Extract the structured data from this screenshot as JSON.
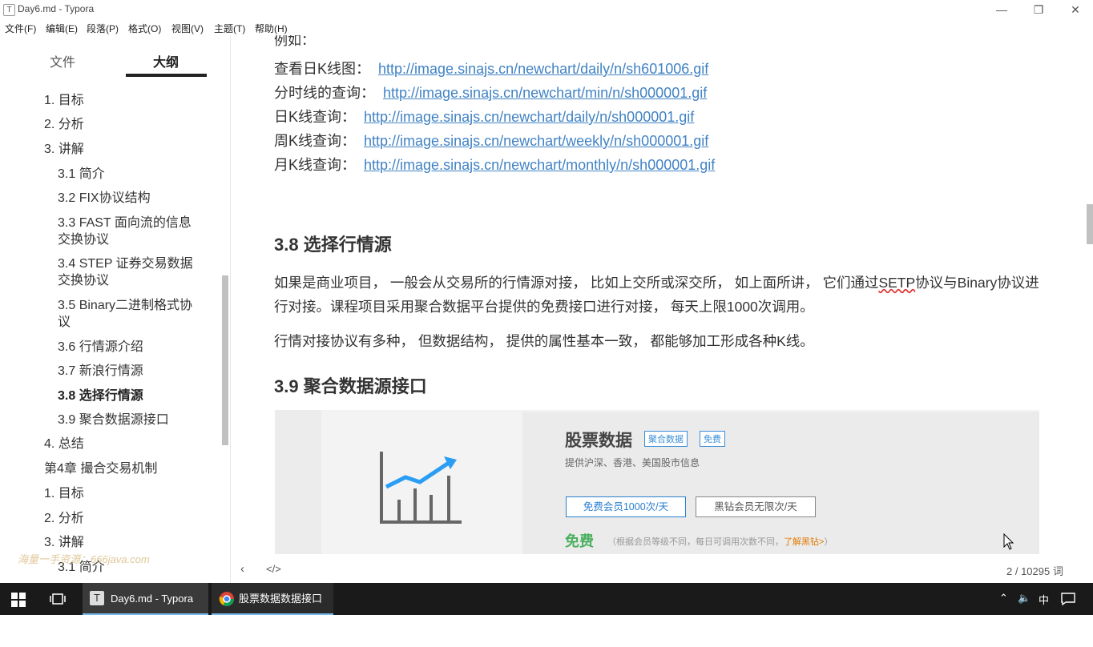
{
  "window": {
    "title": "Day6.md - Typora",
    "app_icon": "T"
  },
  "menu": [
    "文件(F)",
    "编辑(E)",
    "段落(P)",
    "格式(O)",
    "视图(V)",
    "主题(T)",
    "帮助(H)"
  ],
  "sidebar": {
    "tab_file": "文件",
    "tab_outline": "大纲",
    "outline": [
      "1. 目标",
      "2. 分析",
      "3. 讲解",
      "3.1 简介",
      "3.2 FIX协议结构",
      "3.3 FAST 面向流的信息",
      "交换协议",
      "3.4 STEP 证券交易数据",
      "交换协议",
      "3.5 Binary二进制格式协",
      "议",
      "3.6 行情源介绍",
      "3.7 新浪行情源",
      "3.8 选择行情源",
      "3.9 聚合数据源接口",
      "4. 总结",
      "第4章 撮合交易机制",
      "1. 目标",
      "2. 分析",
      "3. 讲解",
      "3.1 简介"
    ],
    "watermark": "海量一手资源：666java.com"
  },
  "content": {
    "cut_text": "例如：",
    "links": [
      {
        "label": "查看日K线图：",
        "url": "http://image.sinajs.cn/newchart/daily/n/sh601006.gif"
      },
      {
        "label": "分时线的查询：",
        "url": "http://image.sinajs.cn/newchart/min/n/sh000001.gif"
      },
      {
        "label": "日K线查询：",
        "url": "http://image.sinajs.cn/newchart/daily/n/sh000001.gif"
      },
      {
        "label": "周K线查询：",
        "url": "http://image.sinajs.cn/newchart/weekly/n/sh000001.gif"
      },
      {
        "label": "月K线查询：",
        "url": "http://image.sinajs.cn/newchart/monthly/n/sh000001.gif"
      }
    ],
    "h38": "3.8 选择行情源",
    "p1_a": "如果是商业项目， 一般会从交易所的行情源对接， 比如上交所或深交所， 如上面所讲， 它们通过",
    "p1_spell": "SETP",
    "p1_b": "协议与Binary协议进行对接。课程项目采用聚合数据平台提供的免费接口进行对接， 每天上限1000次调用。",
    "p2": "行情对接协议有多种， 但数据结构， 提供的属性基本一致， 都能够加工形成各种K线。",
    "h39": "3.9 聚合数据源接口",
    "image": {
      "title": "股票数据",
      "tag1": "聚合数据",
      "tag2": "免费",
      "sub": "提供沪深、香港、美国股市信息",
      "plan1": "免费会员1000次/天",
      "plan2": "黑钻会员无限次/天",
      "free": "免费",
      "note": "（根据会员等级不同，每日可调用次数不同，",
      "note_link": "了解黑钻>",
      "note_end": "）"
    }
  },
  "footer": {
    "word_count": "2 / 10295 词"
  },
  "taskbar": {
    "tasks": [
      {
        "label": "Day6.md - Typora"
      },
      {
        "label": "股票数据数据接口_..."
      }
    ],
    "ime": "中"
  }
}
